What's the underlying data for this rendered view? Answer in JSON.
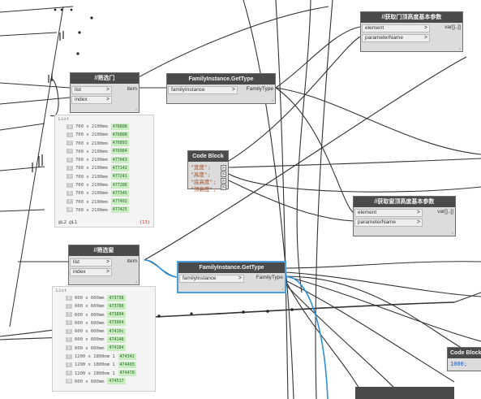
{
  "nodes": {
    "filter_door": {
      "title": "//筛选门",
      "inputs": [
        "list",
        "index"
      ],
      "output": "item",
      "watch": {
        "header": "List",
        "rows": [
          {
            "index": "0",
            "size": "700 x 2100mm",
            "id": "476808"
          },
          {
            "index": "1",
            "size": "700 x 2100mm",
            "id": "476868"
          },
          {
            "index": "2",
            "size": "700 x 2100mm",
            "id": "476893"
          },
          {
            "index": "3",
            "size": "700 x 2100mm",
            "id": "476984"
          },
          {
            "index": "4",
            "size": "700 x 2100mm",
            "id": "477043"
          },
          {
            "index": "5",
            "size": "700 x 2100mm",
            "id": "477142"
          },
          {
            "index": "6",
            "size": "700 x 2100mm",
            "id": "477241"
          },
          {
            "index": "7",
            "size": "700 x 2100mm",
            "id": "477286"
          },
          {
            "index": "8",
            "size": "700 x 2100mm",
            "id": "477345"
          },
          {
            "index": "9",
            "size": "700 x 2100mm",
            "id": "477402"
          },
          {
            "index": "10",
            "size": "700 x 2100mm",
            "id": "477425"
          }
        ],
        "footer": "@L2 @L1",
        "count": "{13}"
      }
    },
    "filter_window": {
      "title": "//筛选窗",
      "inputs": [
        "list",
        "index"
      ],
      "output": "item",
      "watch": {
        "header": "List",
        "rows": [
          {
            "index": "0",
            "size": "600 x 600mm",
            "id": "473738"
          },
          {
            "index": "1",
            "size": "600 x 600mm",
            "id": "473780"
          },
          {
            "index": "2",
            "size": "600 x 600mm",
            "id": "473894"
          },
          {
            "index": "3",
            "size": "600 x 600mm",
            "id": "473964"
          },
          {
            "index": "4",
            "size": "600 x 600mm",
            "id": "47410c"
          },
          {
            "index": "5",
            "size": "600 x 600mm",
            "id": "474148"
          },
          {
            "index": "6",
            "size": "600 x 600mm",
            "id": "474184"
          },
          {
            "index": "7",
            "size": "1200 x 1800mm 1",
            "id": "474342"
          },
          {
            "index": "8",
            "size": "1200 x 1800mm 1",
            "id": "474403"
          },
          {
            "index": "9",
            "size": "1200 x 1800mm 1",
            "id": "474478"
          },
          {
            "index": "10",
            "size": "600 x 600mm",
            "id": "474517"
          }
        ]
      }
    },
    "gettype_door": {
      "title": "FamilyInstance.GetType",
      "input": "familyInstance",
      "output": "FamilyType"
    },
    "gettype_window": {
      "title": "FamilyInstance.GetType",
      "input": "familyInstance",
      "output": "FamilyType"
    },
    "code_block": {
      "title": "Code Block",
      "lines": [
        "\"宽度\";",
        "\"高度\";",
        "\"底高度\";",
        "\"顶高度\";"
      ],
      "out_symbol": ">"
    },
    "param_door": {
      "title": "//获取门顶高度基本参数",
      "inputs": [
        "element",
        "parameterName"
      ],
      "output": "var[]..[]"
    },
    "param_window": {
      "title": "//获取窗顶高度基本参数",
      "inputs": [
        "element",
        "parameterName"
      ],
      "output": "var[]..[]"
    },
    "code_block_2": {
      "title": "Code Block",
      "code": "1000;"
    }
  },
  "colors": {
    "node_header": "#4a4a4a",
    "node_body": "#dcdcdc",
    "wire": "#333333",
    "selected_wire": "#2f8fd8",
    "watch_tag": "#c9ecc0"
  }
}
